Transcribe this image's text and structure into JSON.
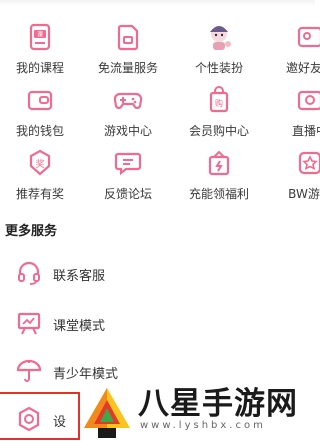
{
  "grid": [
    {
      "label": "我的课程",
      "icon": "course-icon"
    },
    {
      "label": "免流量服务",
      "icon": "sim-card-icon"
    },
    {
      "label": "个性装扮",
      "icon": "character-avatar-icon"
    },
    {
      "label": "邀好友赚",
      "icon": "invite-icon"
    },
    {
      "label": "我的钱包",
      "icon": "wallet-icon"
    },
    {
      "label": "游戏中心",
      "icon": "gamepad-icon"
    },
    {
      "label": "会员购中心",
      "icon": "shopping-bag-icon"
    },
    {
      "label": "直播中",
      "icon": "live-tv-icon"
    },
    {
      "label": "推荐有奖",
      "icon": "award-badge-icon"
    },
    {
      "label": "反馈论坛",
      "icon": "feedback-chat-icon"
    },
    {
      "label": "充能领福利",
      "icon": "gift-icon"
    },
    {
      "label": "BW游戏",
      "icon": "star-badge-icon"
    }
  ],
  "more_services": {
    "title": "更多服务",
    "items": [
      {
        "label": "联系客服",
        "icon": "headset-icon"
      },
      {
        "label": "课堂模式",
        "icon": "classroom-icon"
      },
      {
        "label": "青少年模式",
        "icon": "umbrella-icon"
      },
      {
        "label": "设",
        "icon": "settings-icon"
      }
    ]
  },
  "watermark": {
    "title": "八星手游网",
    "url": "www.lyshbx.com"
  },
  "colors": {
    "accent": "#f06b8f",
    "text": "#333333",
    "highlight": "#e0322b"
  }
}
